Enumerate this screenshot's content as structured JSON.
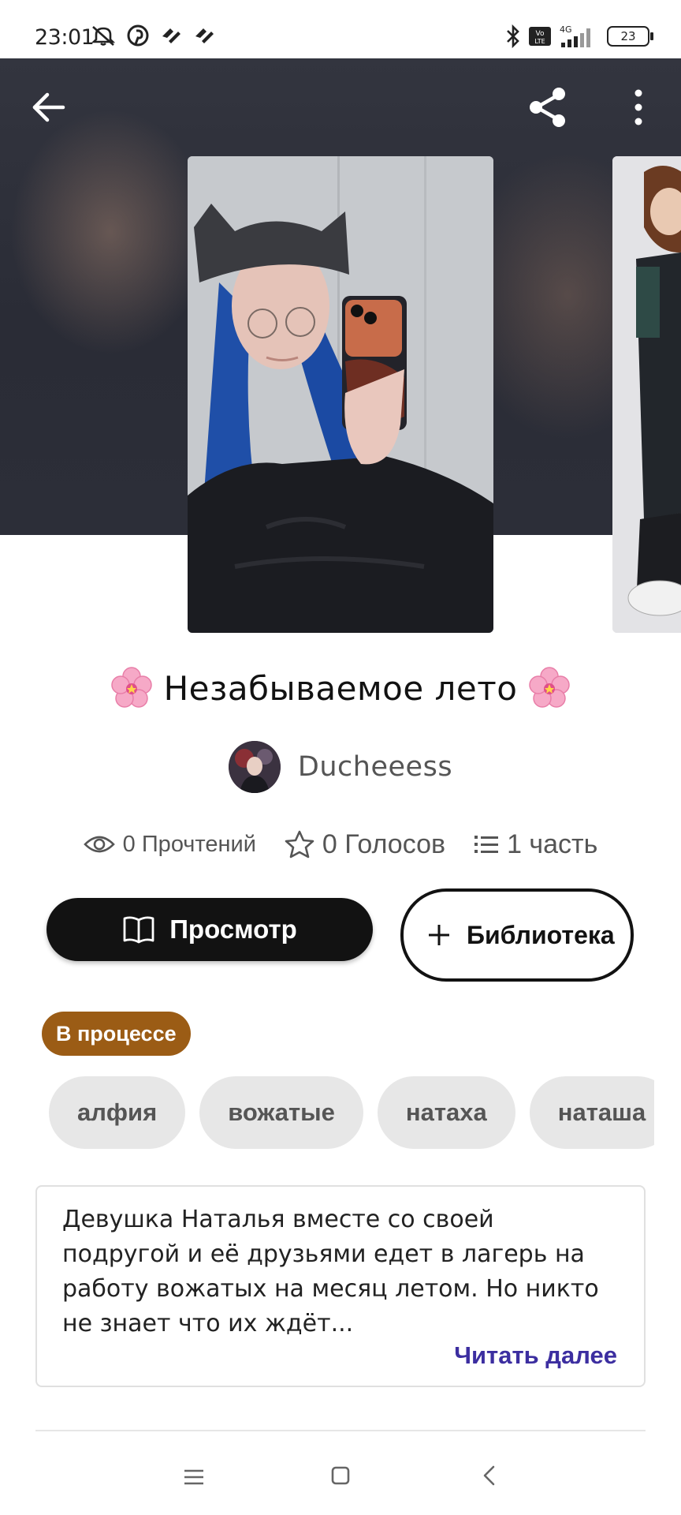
{
  "status_bar": {
    "time": "23:01",
    "battery": "23",
    "network": "4G",
    "left_icons": [
      "mute-icon",
      "pinterest-icon",
      "app-icon",
      "app-icon"
    ],
    "right_icons": [
      "bluetooth-icon",
      "volte-icon",
      "signal-icon",
      "battery-icon"
    ]
  },
  "header": {
    "icons": [
      "back-arrow-icon",
      "share-icon",
      "more-vertical-icon"
    ]
  },
  "story": {
    "title": "Незабываемое лето",
    "author": "Ducheeess"
  },
  "stats": {
    "reads": "0 Прочтений",
    "votes": "0 Голосов",
    "parts": "1 часть"
  },
  "actions": {
    "read_label": "Просмотр",
    "library_label": "Библиотека"
  },
  "status_badge": "В процессе",
  "tags": [
    "алфия",
    "вожатые",
    "натаха",
    "наташа"
  ],
  "description": {
    "text": "Девушка Наталья вместе со своей подругой и её друзьями едет в лагерь на работу вожатых на месяц летом. Но никто не знает что их ждёт...",
    "read_more": "Читать далее"
  },
  "colors": {
    "primary": "#121212",
    "badge": "#9b5c15",
    "link": "#3c2ea0",
    "tag_bg": "#e7e7e7"
  }
}
